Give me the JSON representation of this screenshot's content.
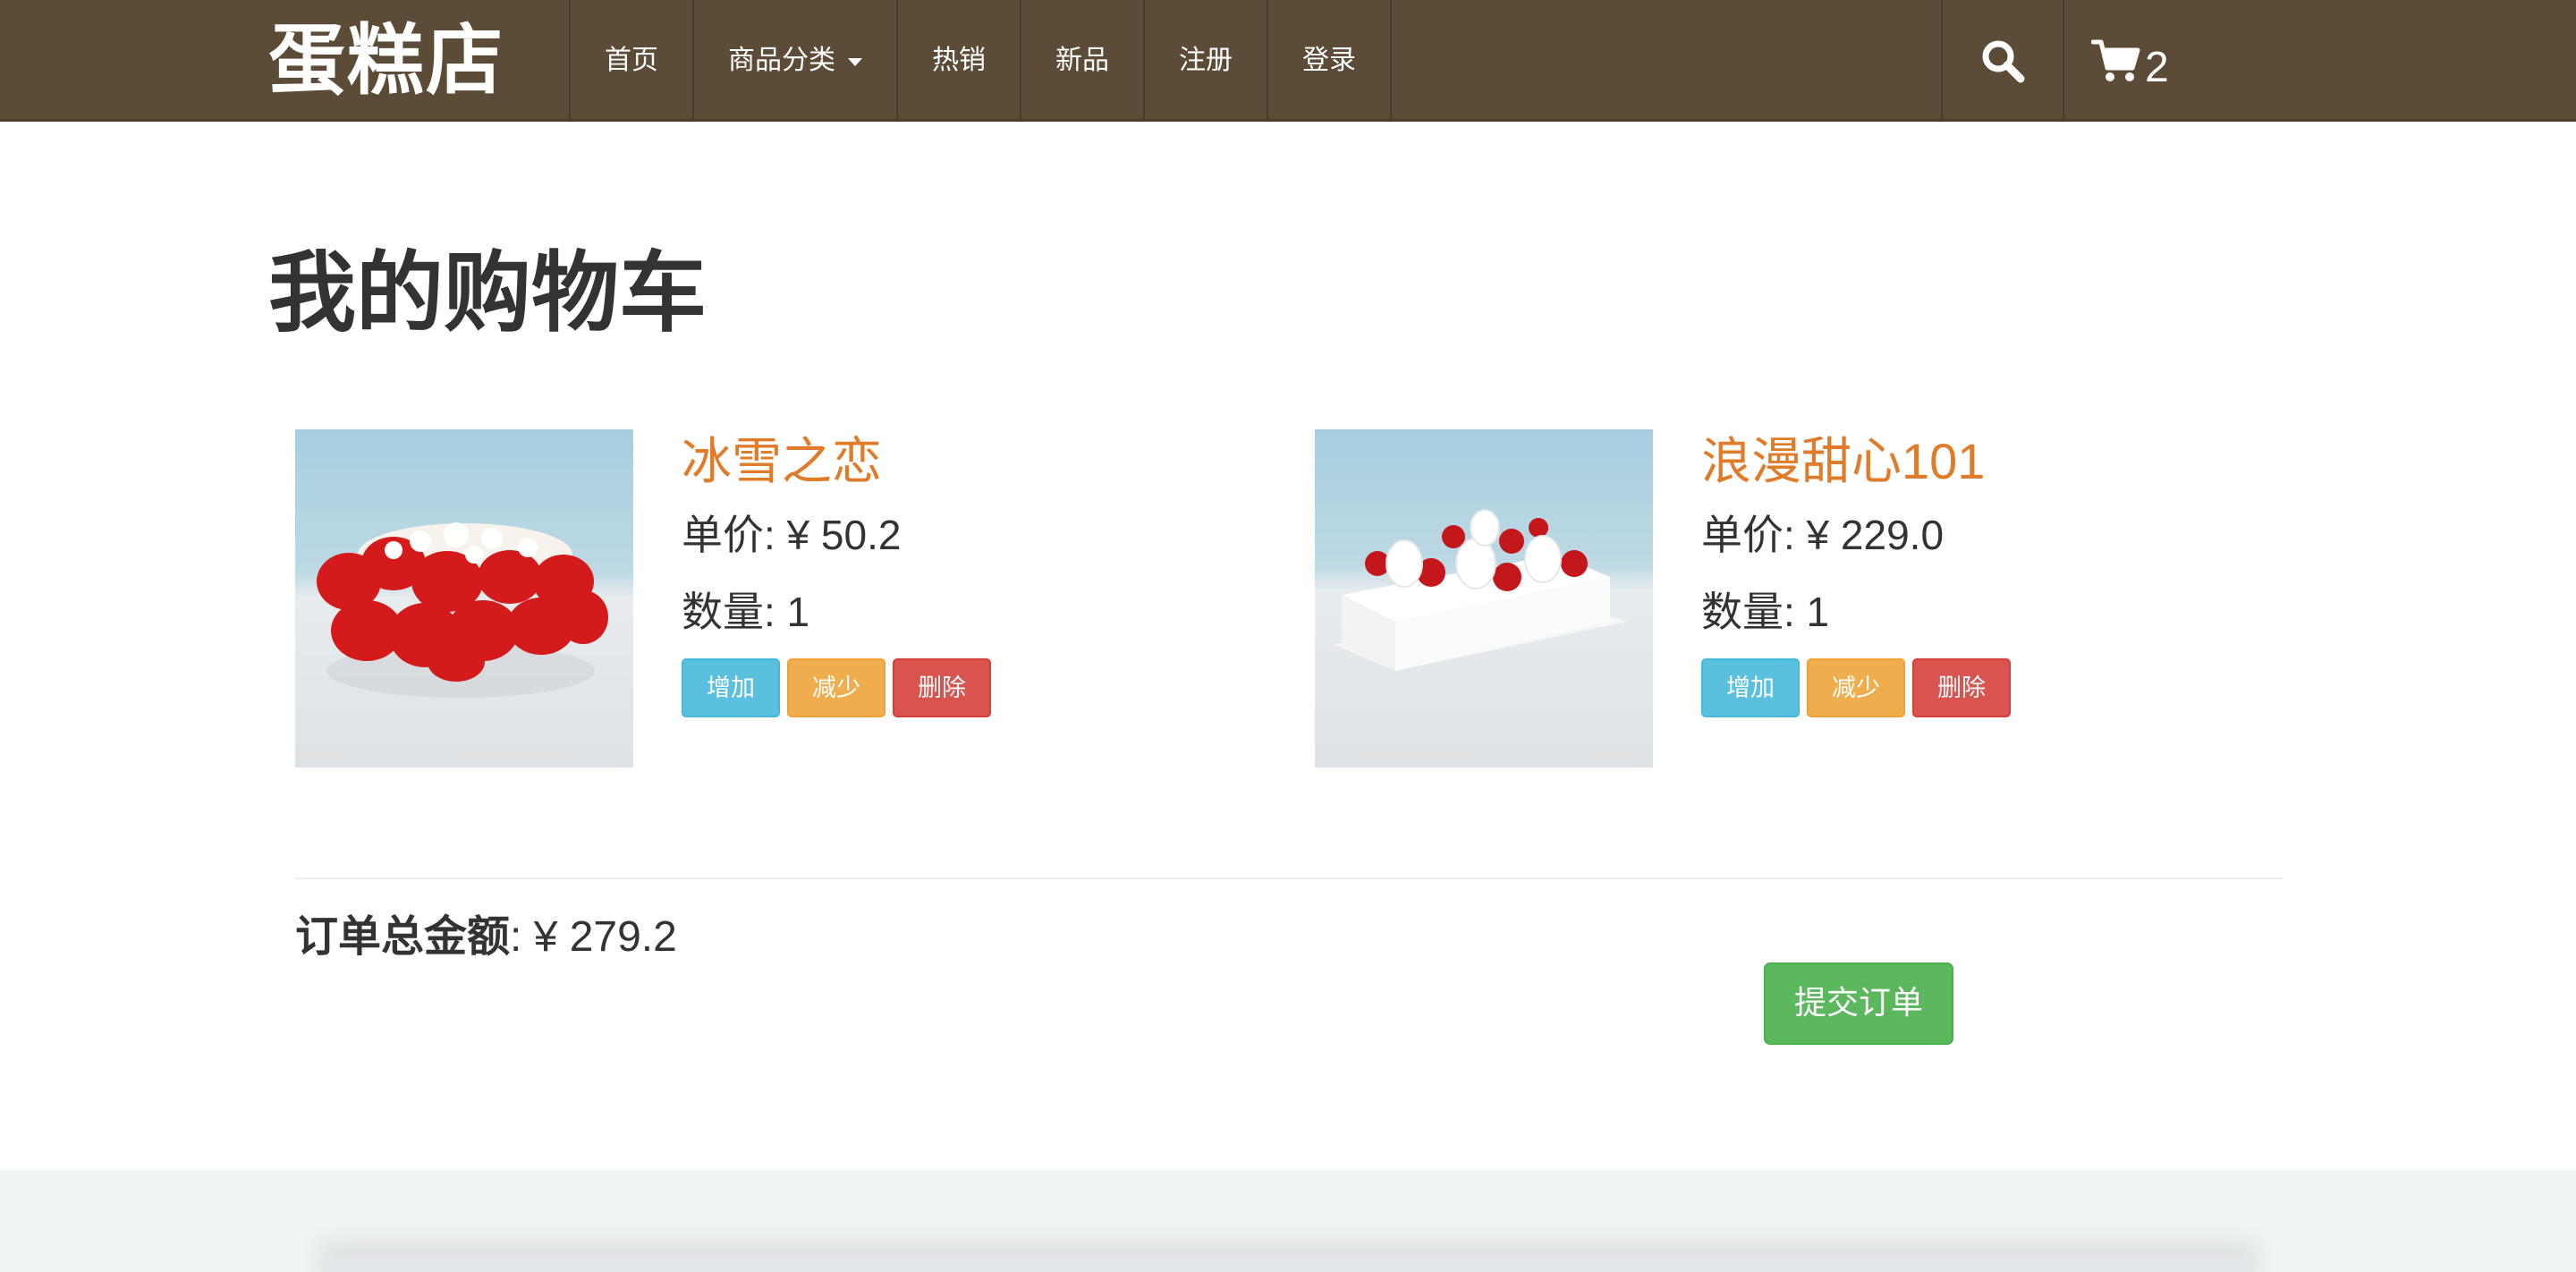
{
  "navbar": {
    "brand": "蛋糕店",
    "items": [
      {
        "label": "首页"
      },
      {
        "label": "商品分类",
        "dropdown": true
      },
      {
        "label": "热销"
      },
      {
        "label": "新品"
      },
      {
        "label": "注册"
      },
      {
        "label": "登录"
      }
    ],
    "search_icon": "search-icon",
    "cart_icon": "shopping-cart-icon",
    "cart_count": "2"
  },
  "page": {
    "title": "我的购物车"
  },
  "cart": {
    "items": [
      {
        "name": "冰雪之恋",
        "price_label": "单价: ¥ 50.2",
        "qty_label": "数量: 1",
        "image": "red-rose-petal-cake"
      },
      {
        "name": "浪漫甜心101",
        "price_label": "单价: ¥ 229.0",
        "qty_label": "数量: 1",
        "image": "white-strawberry-cake"
      }
    ],
    "buttons": {
      "increase": "增加",
      "decrease": "减少",
      "delete": "删除"
    },
    "total_label": "订单总金额",
    "total_value": ": ¥ 279.2",
    "submit": "提交订单"
  },
  "colors": {
    "navbar": "#5c4b37",
    "product_name": "#e07b2a",
    "btn_info": "#5bc0de",
    "btn_warning": "#f0ad4e",
    "btn_danger": "#d9534f",
    "btn_success": "#5cb85c",
    "footer": "#f1f4f5"
  }
}
